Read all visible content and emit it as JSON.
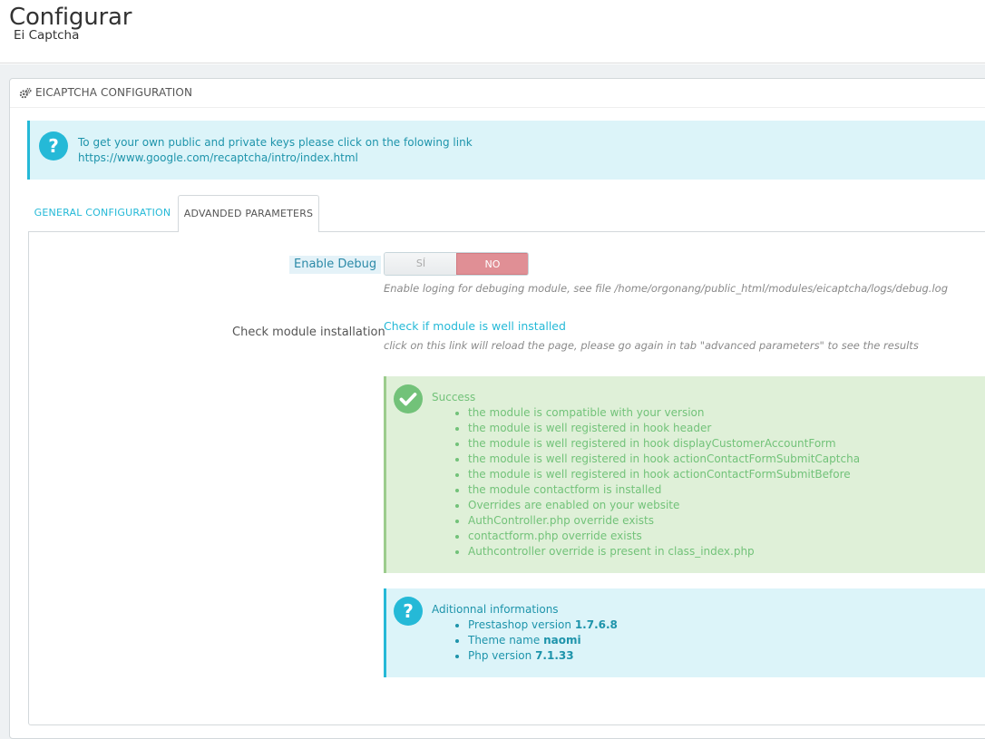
{
  "header": {
    "title": "Configurar",
    "subtitle": "Ei Captcha"
  },
  "panel": {
    "title": "EICAPTCHA CONFIGURATION",
    "info": {
      "line1": "To get your own public and private keys please click on the folowing link",
      "link": "https://www.google.com/recaptcha/intro/index.html"
    }
  },
  "tabs": [
    {
      "label": "GENERAL CONFIGURATION",
      "active": false
    },
    {
      "label": "ADVANDED PARAMETERS",
      "active": true
    }
  ],
  "form": {
    "debug": {
      "label": "Enable Debug",
      "yes": "SÍ",
      "no": "NO",
      "value": "NO",
      "help": "Enable loging for debuging module, see file /home/orgonang/public_html/modules/eicaptcha/logs/debug.log"
    },
    "check": {
      "label": "Check module installation",
      "link": "Check if module is well installed",
      "help": "click on this link will reload the page, please go again in tab \"advanced parameters\" to see the results"
    }
  },
  "success": {
    "heading": "Success",
    "items": [
      "the module is compatible with your version",
      "the module is well registered in hook header",
      "the module is well registered in hook displayCustomerAccountForm",
      "the module is well registered in hook actionContactFormSubmitCaptcha",
      "the module is well registered in hook actionContactFormSubmitBefore",
      "the module contactform is installed",
      "Overrides are enabled on your website",
      "AuthController.php override exists",
      "contactform.php override exists",
      "Authcontroller override is present in class_index.php"
    ]
  },
  "additional": {
    "heading": "Aditionnal informations",
    "items": [
      {
        "label": "Prestashop version",
        "value": "1.7.6.8"
      },
      {
        "label": "Theme name",
        "value": "naomi"
      },
      {
        "label": "Php version",
        "value": "7.1.33"
      }
    ]
  },
  "colors": {
    "accent": "#25b9d7",
    "success_text": "#72c279",
    "success_bg": "#dff0d8",
    "info_bg": "#dcf4f9",
    "switch_no": "#e08f95"
  },
  "icons": {
    "panel": "cogs-icon",
    "info": "question-circle-icon",
    "success": "check-circle-icon"
  }
}
